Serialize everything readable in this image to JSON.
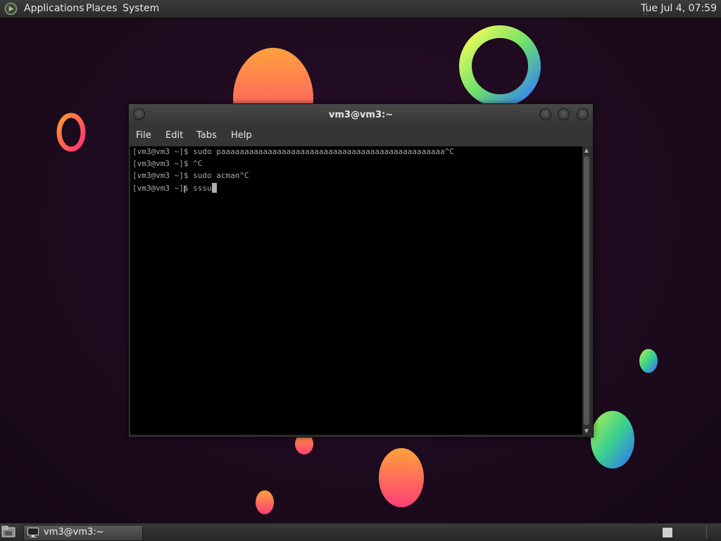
{
  "top_panel": {
    "menus": [
      "Applications",
      "Places",
      "System"
    ],
    "clock": "Tue Jul  4, 07:59"
  },
  "window": {
    "title": "vm3@vm3:~",
    "menu": [
      "File",
      "Edit",
      "Tabs",
      "Help"
    ],
    "lines": [
      "[vm3@vm3 ~]$ sudo paaaaaaaaaaaaaaaaaaaaaaaaaaaaaaaaaaaaaaaaaaaaaaaa^C",
      "[vm3@vm3 ~]$ ^C",
      "[vm3@vm3 ~]$ sudo acman^C",
      "[vm3@vm3 ~]$ sssu"
    ]
  },
  "taskbar": {
    "task_label": "vm3@vm3:~"
  },
  "icons": {
    "apps": "applications-icon",
    "terminal": "terminal-icon",
    "show_desktop": "show-desktop-icon"
  },
  "colors": {
    "terminal_bg": "#000000",
    "terminal_fg": "#a8a8a8",
    "desktop_bg": "#1e0b1f"
  }
}
